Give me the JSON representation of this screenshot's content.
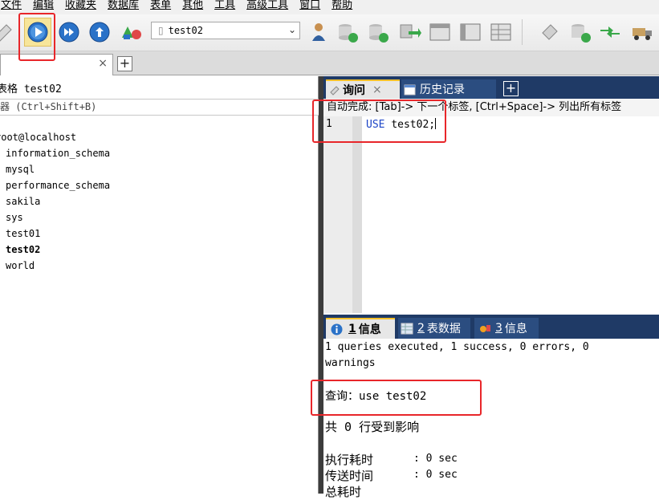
{
  "menubar": {
    "items": [
      "文件",
      "编辑",
      "收藏夹",
      "数据库",
      "表单",
      "其他",
      "工具",
      "高级工具",
      "窗口",
      "帮助"
    ]
  },
  "toolbar": {
    "database_select": "test02",
    "buttons": [
      "refresh-icon",
      "execute-query-icon",
      "execute-all-icon",
      "reexecute-icon",
      "schema-icon",
      "user-icon",
      "db-import-icon",
      "db-export-icon",
      "db-copy-icon",
      "table-icon",
      "table-data-icon",
      "table-grid-icon",
      "tag-icon",
      "backup-icon",
      "sync-icon",
      "truck-icon"
    ]
  },
  "connection_tab": {
    "close": "×",
    "add": "+"
  },
  "left_panel": {
    "title": "表格 test02",
    "filter_hint": "器 (Ctrl+Shift+B)",
    "tree": {
      "root": "root@localhost",
      "databases": [
        "information_schema",
        "mysql",
        "performance_schema",
        "sakila",
        "sys",
        "test01",
        "test02",
        "world"
      ],
      "selected": "test02"
    }
  },
  "editor": {
    "tabs": {
      "query": "询问",
      "query_close": "×",
      "history": "历史记录",
      "add": "+"
    },
    "autocomplete_hint": "自动完成: [Tab]-> 下一个标签, [Ctrl+Space]-> 列出所有标签",
    "line_number": "1",
    "code_keyword": "USE",
    "code_rest": "test02;"
  },
  "results": {
    "tabs": [
      {
        "num": "1",
        "label": "信息"
      },
      {
        "num": "2",
        "label": "表数据"
      },
      {
        "num": "3",
        "label": "信息"
      }
    ],
    "summary_line1": "1 queries executed, 1 success, 0 errors, 0",
    "summary_line2": "warnings",
    "query_label": "查询：use test02",
    "affected_rows": "共 0 行受到影响",
    "exec_time_label": "执行耗时",
    "exec_time_value": ": 0 sec",
    "transfer_time_label": "传送时间",
    "transfer_time_value": ": 0 sec",
    "total_time_label": "总耗时"
  },
  "colors": {
    "highlight": "#e8262a",
    "tab_bar": "#1f3a66",
    "keyword": "#1b44c6"
  }
}
